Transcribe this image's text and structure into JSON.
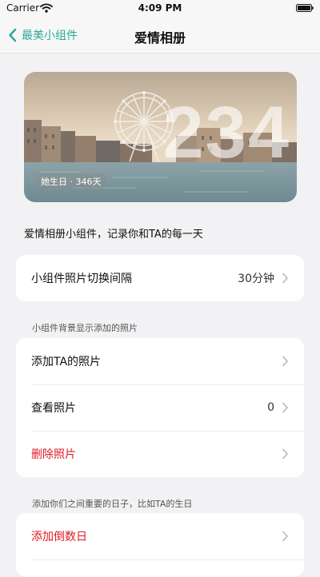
{
  "status_bar": {
    "carrier": "Carrier",
    "time": "4:09 PM"
  },
  "nav": {
    "back_label": "最美小组件",
    "title": "爱情相册"
  },
  "hero": {
    "count": "234",
    "badge": "她生日 · 346天"
  },
  "description": "爱情相册小组件，记录你和TA的每一天",
  "interval_card": {
    "label": "小组件照片切换间隔",
    "value": "30分钟"
  },
  "photo_section": {
    "hint": "小组件背景显示添加的照片",
    "rows": [
      {
        "label": "添加TA的照片",
        "value": ""
      },
      {
        "label": "查看照片",
        "value": "0"
      },
      {
        "label": "删除照片",
        "value": ""
      }
    ]
  },
  "date_section": {
    "hint": "添加你们之间重要的日子，比如TA的生日",
    "rows": [
      {
        "label": "添加倒数日"
      }
    ]
  },
  "colors": {
    "accent": "#2aa79a",
    "danger": "#e01b24",
    "background": "#f2f2f4",
    "card": "#ffffff"
  },
  "icons": [
    "wifi-icon",
    "battery-icon",
    "back-chevron-icon",
    "chevron-right-icon"
  ]
}
